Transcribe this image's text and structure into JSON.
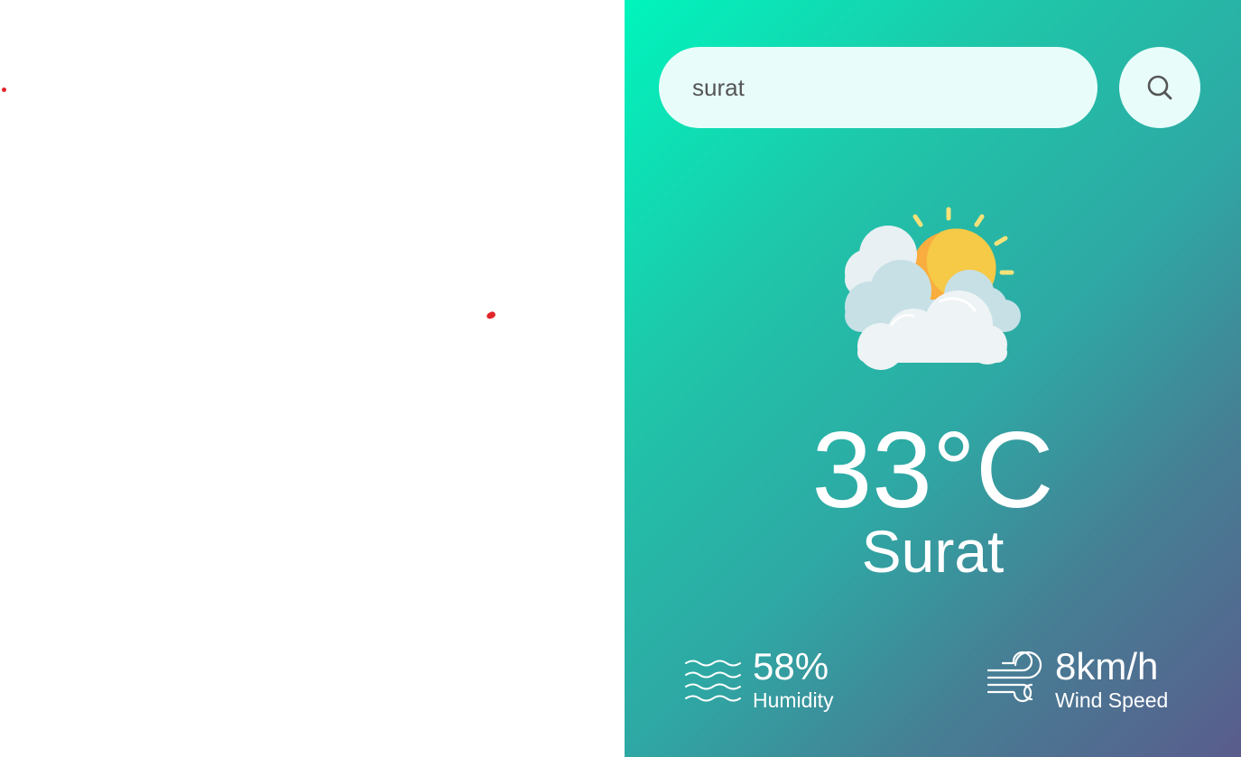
{
  "search": {
    "value": "surat"
  },
  "weather": {
    "icon": "partly-cloudy-icon",
    "temperature": "33°C",
    "city": "Surat"
  },
  "details": {
    "humidity": {
      "icon": "humidity-waves-icon",
      "value": "58%",
      "label": "Humidity"
    },
    "wind": {
      "icon": "wind-icon",
      "value": "8km/h",
      "label": "Wind Speed"
    }
  },
  "colors": {
    "gradient_start": "#00f5bd",
    "gradient_end": "#5a5c8c",
    "input_background": "#e8fdfa",
    "text": "#ffffff"
  }
}
